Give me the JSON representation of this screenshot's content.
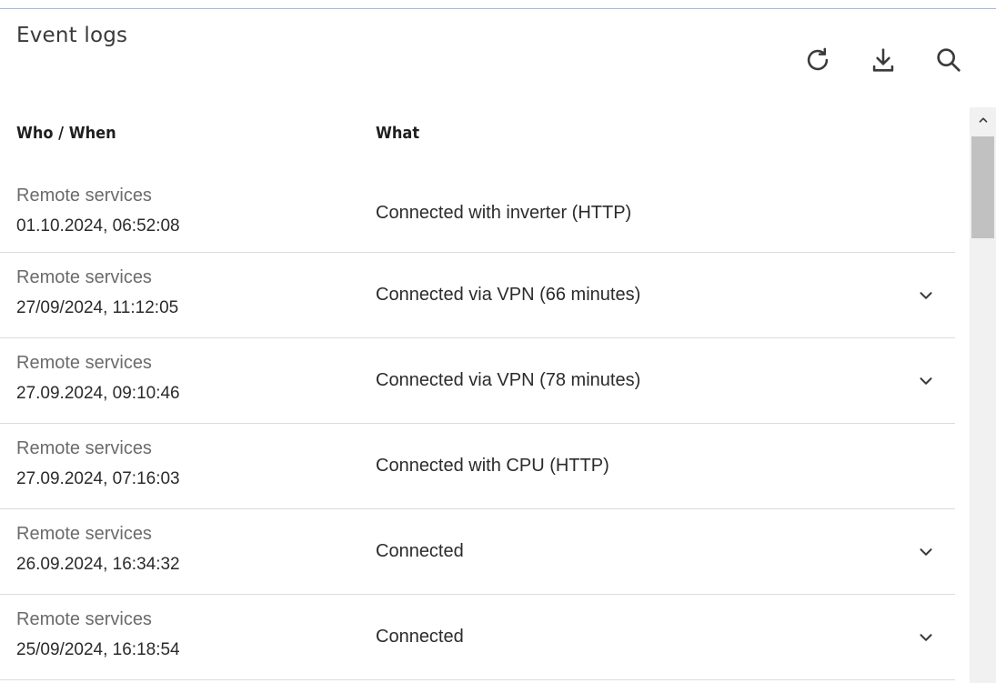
{
  "panel": {
    "title": "Event logs"
  },
  "toolbar": {
    "refresh_icon": "refresh-icon",
    "download_icon": "download-icon",
    "search_icon": "search-icon"
  },
  "table": {
    "headers": {
      "who_when": "Who / When",
      "what": "What"
    },
    "rows": [
      {
        "who": "Remote services",
        "when": "01.10.2024, 06:52:08",
        "what": "Connected with inverter (HTTP)",
        "expandable": false
      },
      {
        "who": "Remote services",
        "when": "27/09/2024, 11:12:05",
        "what": "Connected via VPN (66 minutes)",
        "expandable": true
      },
      {
        "who": "Remote services",
        "when": "27.09.2024, 09:10:46",
        "what": "Connected via VPN (78 minutes)",
        "expandable": true
      },
      {
        "who": "Remote services",
        "when": "27.09.2024, 07:16:03",
        "what": "Connected with CPU (HTTP)",
        "expandable": false
      },
      {
        "who": "Remote services",
        "when": "26.09.2024, 16:34:32",
        "what": "Connected",
        "expandable": true
      },
      {
        "who": "Remote services",
        "when": "25/09/2024, 16:18:54",
        "what": "Connected",
        "expandable": true
      }
    ]
  },
  "colors": {
    "accent_rule": "#9dbbe0",
    "icon": "#3a3a3a",
    "muted_text": "#6b6b6b",
    "divider": "#dcdcdc"
  }
}
